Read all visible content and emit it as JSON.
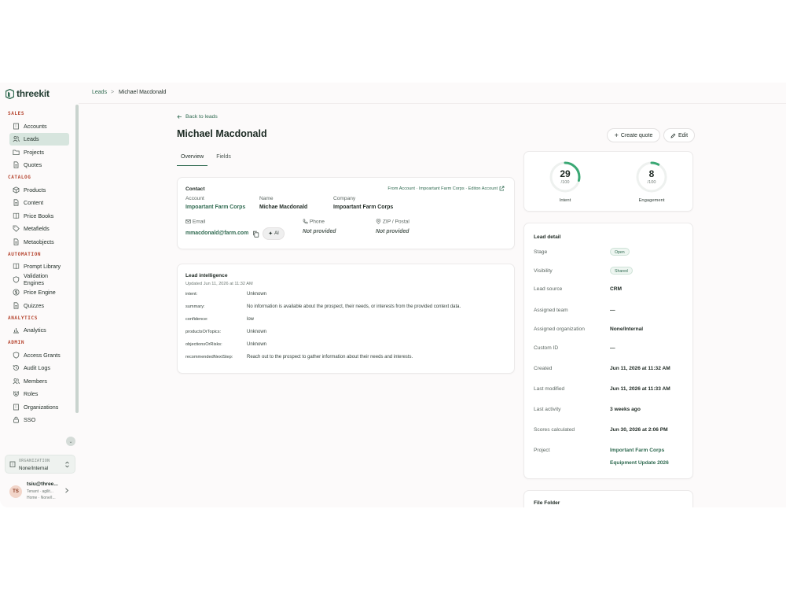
{
  "brand": {
    "name": "threekit",
    "accent": "#2f6a50",
    "section_color": "#b5442e"
  },
  "sidebar": {
    "sections": [
      {
        "title": "SALES",
        "items": [
          {
            "label": "Accounts",
            "icon": "building-icon"
          },
          {
            "label": "Leads",
            "icon": "users-icon",
            "active": true
          },
          {
            "label": "Projects",
            "icon": "folder-icon"
          },
          {
            "label": "Quotes",
            "icon": "file-icon"
          }
        ]
      },
      {
        "title": "CATALOG",
        "items": [
          {
            "label": "Products",
            "icon": "package-icon"
          },
          {
            "label": "Content",
            "icon": "file-icon"
          },
          {
            "label": "Price Books",
            "icon": "book-icon"
          },
          {
            "label": "Metafields",
            "icon": "tag-icon"
          },
          {
            "label": "Metaobjects",
            "icon": "file-icon"
          }
        ]
      },
      {
        "title": "AUTOMATION",
        "items": [
          {
            "label": "Prompt Library",
            "icon": "book-icon"
          },
          {
            "label": "Validation Engines",
            "icon": "shield-icon"
          },
          {
            "label": "Price Engine",
            "icon": "dollar-icon"
          },
          {
            "label": "Quizzes",
            "icon": "file-icon"
          }
        ]
      },
      {
        "title": "ANALYTICS",
        "items": [
          {
            "label": "Analytics",
            "icon": "chart-icon"
          }
        ]
      },
      {
        "title": "ADMIN",
        "items": [
          {
            "label": "Access Grants",
            "icon": "shield-icon"
          },
          {
            "label": "Audit Logs",
            "icon": "history-icon"
          },
          {
            "label": "Members",
            "icon": "users-icon"
          },
          {
            "label": "Roles",
            "icon": "magnet-icon"
          },
          {
            "label": "Organizations",
            "icon": "building-icon"
          },
          {
            "label": "SSO",
            "icon": "lock-icon"
          }
        ]
      }
    ],
    "org": {
      "label": "ORGANIZATION",
      "value": "None/Internal"
    },
    "user": {
      "initials": "TS",
      "name": "tsiu@three...",
      "line1": "Tenant · agilit...",
      "line2": "Home · None/I..."
    }
  },
  "breadcrumb": {
    "root": "Leads",
    "separator": ">",
    "current": "Michael Macdonald"
  },
  "page": {
    "back_label": "Back to leads",
    "title": "Michael Macdonald",
    "create_quote_label": "Create quote",
    "edit_label": "Edit",
    "tabs": [
      "Overview",
      "Fields"
    ]
  },
  "contact": {
    "title": "Contact",
    "source_link": "From Account · Impoartant Farm Corps · Editon Account",
    "account_label": "Account",
    "account_value": "Impoartant Farm Corps",
    "name_label": "Name",
    "name_value": "Michae Macdonald",
    "company_label": "Company",
    "company_value": "Impoartant Farm Corps",
    "email_label": "Email",
    "email_value": "mmacdonald@farm.com",
    "ai_label": "AI",
    "phone_label": "Phone",
    "phone_value": "Not provided",
    "zip_label": "ZIP / Postal",
    "zip_value": "Not provided"
  },
  "intelligence": {
    "title": "Lead intelligence",
    "updated": "Updated Jun 11, 2026 at 11:32 AM",
    "rows": [
      {
        "key": "intent:",
        "value": "Unknown"
      },
      {
        "key": "summary:",
        "value": "No information is available about the prospect, their needs, or interests from the provided context data."
      },
      {
        "key": "confidence:",
        "value": "low"
      },
      {
        "key": "productsOrTopics:",
        "value": "Unknown"
      },
      {
        "key": "objectionsOrRisks:",
        "value": "Unknown"
      },
      {
        "key": "recommendedNextStep:",
        "value": "Reach out to the prospect to gather information about their needs and interests."
      }
    ]
  },
  "scores": [
    {
      "value": "29",
      "max": "/100",
      "label": "Intent",
      "fraction": 0.29
    },
    {
      "value": "8",
      "max": "/100",
      "label": "Engagement",
      "fraction": 0.08
    }
  ],
  "lead_detail": {
    "title": "Lead detail",
    "rows": [
      {
        "key": "Stage",
        "value": "Open",
        "pill": true
      },
      {
        "key": "Visibility",
        "value": "Shared",
        "pill": true
      },
      {
        "key": "Lead source",
        "value": "CRM"
      },
      {
        "key": "Assigned team",
        "value": "—"
      },
      {
        "key": "Assigned organization",
        "value": "None/Internal"
      },
      {
        "key": "Custom ID",
        "value": "—"
      },
      {
        "key": "Created",
        "value": "Jun 11, 2026 at 11:32 AM"
      },
      {
        "key": "Last modified",
        "value": "Jun 11, 2026 at 11:33 AM"
      },
      {
        "key": "Last activity",
        "value": "3 weeks ago"
      },
      {
        "key": "Scores calculated",
        "value": "Jun 30, 2026 at 2:06 PM"
      },
      {
        "key": "Project",
        "value": "Important Farm Corps",
        "value2": "Equipment Update 2026",
        "link": true
      }
    ]
  },
  "files": {
    "title": "File Folder"
  }
}
